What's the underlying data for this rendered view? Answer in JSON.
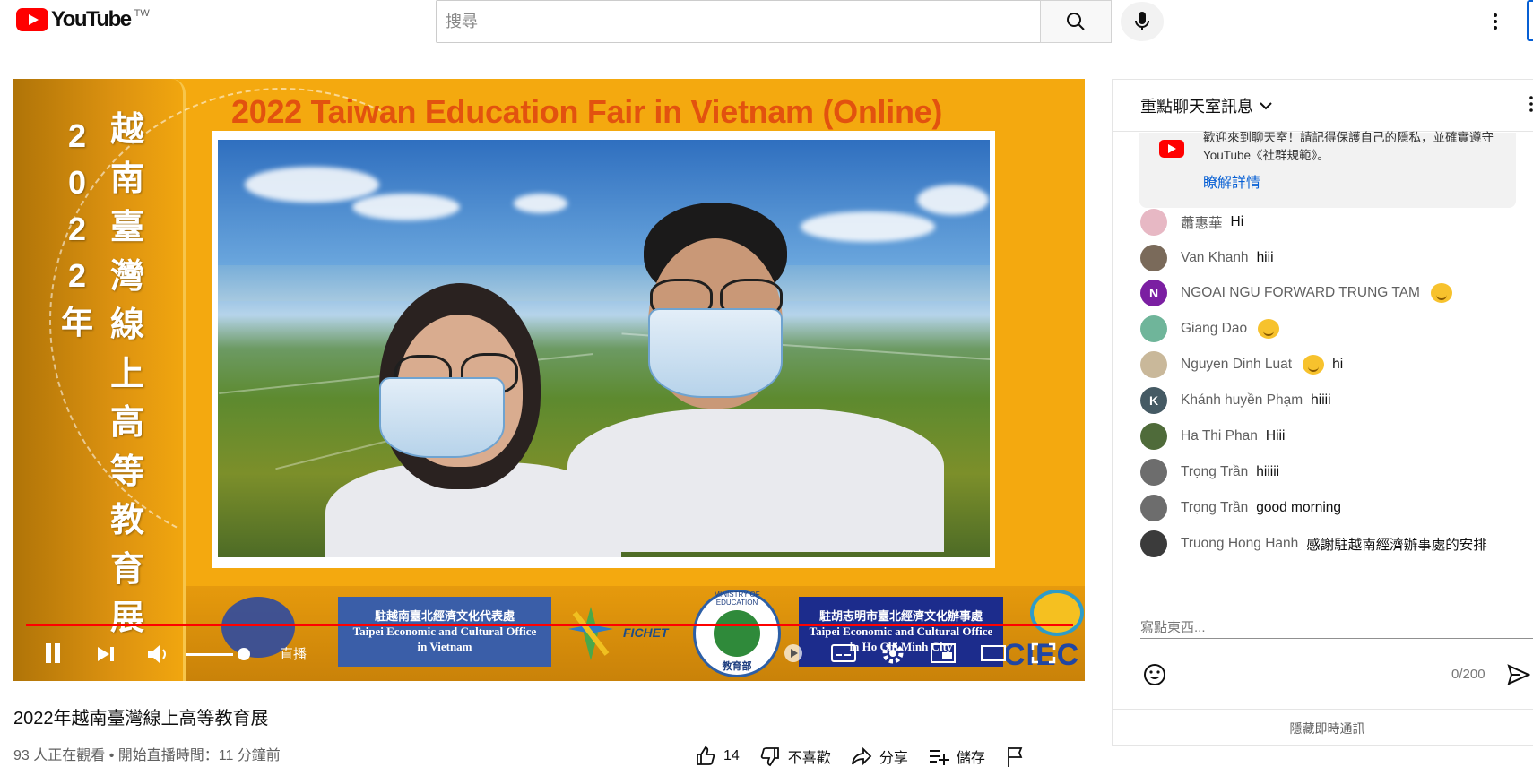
{
  "header": {
    "logo_text": "YouTube",
    "country_code": "TW",
    "search_placeholder": "搜尋",
    "icons": [
      "youtube-logo-icon",
      "search-icon",
      "mic-icon",
      "more-vert-icon"
    ]
  },
  "player": {
    "fair_title": "2022 Taiwan Education Fair in Vietnam (Online)",
    "vertical_year": [
      "2",
      "0",
      "2",
      "2",
      "年"
    ],
    "vertical_title": [
      "越",
      "南",
      "臺",
      "灣",
      "線",
      "上",
      "高",
      "等",
      "教",
      "育",
      "展"
    ],
    "office1_zh": "駐越南臺北經濟文化代表處",
    "office1_en": [
      "Taipei Economic and Cultural Office",
      "in Vietnam"
    ],
    "office2_zh": "駐胡志明市臺北經濟文化辦事處",
    "office2_en": [
      "Taipei Economic and Cultural Office",
      "in Ho Chi Minh City"
    ],
    "seal_text": "MINISTRY OF EDUCATION",
    "seal_zh": "教育部",
    "fichet_text": "FICHET",
    "ciec_text": "CIEC",
    "live_label": "直播",
    "progress_fraction": 1.0,
    "volume_fraction": 1.0,
    "accent_red": "#ff0000"
  },
  "video": {
    "title": "2022年越南臺灣線上高等教育展",
    "meta": "93 人正在觀看 • 開始直播時間：11 分鐘前",
    "actions": {
      "like_count": "14",
      "dislike": "不喜歡",
      "share": "分享",
      "save": "儲存"
    }
  },
  "chat": {
    "header_title": "重點聊天室訊息",
    "welcome_text": "歡迎來到聊天室！請記得保護自己的隱私，並確實遵守 YouTube《社群規範》。",
    "welcome_link": "瞭解詳情",
    "messages": [
      {
        "author": "蕭惠華",
        "text": "Hi",
        "avatar_color": "#e7b8c4",
        "initial": ""
      },
      {
        "author": "Van Khanh",
        "text": "hiii",
        "avatar_color": "#7a6a5a",
        "initial": ""
      },
      {
        "author": "NGOAI NGU FORWARD TRUNG TAM",
        "text": "",
        "avatar_color": "#7b1fa2",
        "initial": "N",
        "emoji": "hugging-face-emoji"
      },
      {
        "author": "Giang Dao",
        "text": "",
        "avatar_color": "#6fb59a",
        "initial": "",
        "emoji": "smiling-face-emoji"
      },
      {
        "author": "Nguyen Dinh Luat",
        "text": "hi",
        "avatar_color": "#c9b89a",
        "initial": "",
        "emoji": "waving-hand-emoji"
      },
      {
        "author": "Khánh huyền Phạm",
        "text": "hiiii",
        "avatar_color": "#455a64",
        "initial": "K"
      },
      {
        "author": "Ha Thi Phan",
        "text": "Hiii",
        "avatar_color": "#4f6b3a",
        "initial": ""
      },
      {
        "author": "Trọng Trần",
        "text": "hiiiii",
        "avatar_color": "#6d6d6d",
        "initial": ""
      },
      {
        "author": "Trọng Trần",
        "text": "good morning",
        "avatar_color": "#6d6d6d",
        "initial": ""
      },
      {
        "author": "Truong Hong Hanh",
        "text": "感謝駐越南經濟辦事處的安排",
        "avatar_color": "#3b3b3b",
        "initial": ""
      }
    ],
    "input_placeholder": "寫點東西...",
    "char_count": "0/200",
    "hide_chat": "隱藏即時通訊"
  }
}
